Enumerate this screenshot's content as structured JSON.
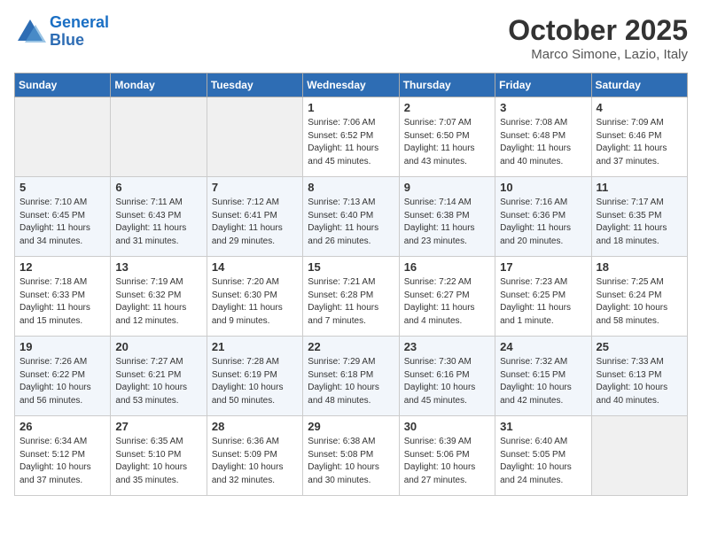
{
  "header": {
    "logo_line1": "General",
    "logo_line2": "Blue",
    "month": "October 2025",
    "location": "Marco Simone, Lazio, Italy"
  },
  "weekdays": [
    "Sunday",
    "Monday",
    "Tuesday",
    "Wednesday",
    "Thursday",
    "Friday",
    "Saturday"
  ],
  "weeks": [
    [
      {
        "day": "",
        "info": ""
      },
      {
        "day": "",
        "info": ""
      },
      {
        "day": "",
        "info": ""
      },
      {
        "day": "1",
        "info": "Sunrise: 7:06 AM\nSunset: 6:52 PM\nDaylight: 11 hours and 45 minutes."
      },
      {
        "day": "2",
        "info": "Sunrise: 7:07 AM\nSunset: 6:50 PM\nDaylight: 11 hours and 43 minutes."
      },
      {
        "day": "3",
        "info": "Sunrise: 7:08 AM\nSunset: 6:48 PM\nDaylight: 11 hours and 40 minutes."
      },
      {
        "day": "4",
        "info": "Sunrise: 7:09 AM\nSunset: 6:46 PM\nDaylight: 11 hours and 37 minutes."
      }
    ],
    [
      {
        "day": "5",
        "info": "Sunrise: 7:10 AM\nSunset: 6:45 PM\nDaylight: 11 hours and 34 minutes."
      },
      {
        "day": "6",
        "info": "Sunrise: 7:11 AM\nSunset: 6:43 PM\nDaylight: 11 hours and 31 minutes."
      },
      {
        "day": "7",
        "info": "Sunrise: 7:12 AM\nSunset: 6:41 PM\nDaylight: 11 hours and 29 minutes."
      },
      {
        "day": "8",
        "info": "Sunrise: 7:13 AM\nSunset: 6:40 PM\nDaylight: 11 hours and 26 minutes."
      },
      {
        "day": "9",
        "info": "Sunrise: 7:14 AM\nSunset: 6:38 PM\nDaylight: 11 hours and 23 minutes."
      },
      {
        "day": "10",
        "info": "Sunrise: 7:16 AM\nSunset: 6:36 PM\nDaylight: 11 hours and 20 minutes."
      },
      {
        "day": "11",
        "info": "Sunrise: 7:17 AM\nSunset: 6:35 PM\nDaylight: 11 hours and 18 minutes."
      }
    ],
    [
      {
        "day": "12",
        "info": "Sunrise: 7:18 AM\nSunset: 6:33 PM\nDaylight: 11 hours and 15 minutes."
      },
      {
        "day": "13",
        "info": "Sunrise: 7:19 AM\nSunset: 6:32 PM\nDaylight: 11 hours and 12 minutes."
      },
      {
        "day": "14",
        "info": "Sunrise: 7:20 AM\nSunset: 6:30 PM\nDaylight: 11 hours and 9 minutes."
      },
      {
        "day": "15",
        "info": "Sunrise: 7:21 AM\nSunset: 6:28 PM\nDaylight: 11 hours and 7 minutes."
      },
      {
        "day": "16",
        "info": "Sunrise: 7:22 AM\nSunset: 6:27 PM\nDaylight: 11 hours and 4 minutes."
      },
      {
        "day": "17",
        "info": "Sunrise: 7:23 AM\nSunset: 6:25 PM\nDaylight: 11 hours and 1 minute."
      },
      {
        "day": "18",
        "info": "Sunrise: 7:25 AM\nSunset: 6:24 PM\nDaylight: 10 hours and 58 minutes."
      }
    ],
    [
      {
        "day": "19",
        "info": "Sunrise: 7:26 AM\nSunset: 6:22 PM\nDaylight: 10 hours and 56 minutes."
      },
      {
        "day": "20",
        "info": "Sunrise: 7:27 AM\nSunset: 6:21 PM\nDaylight: 10 hours and 53 minutes."
      },
      {
        "day": "21",
        "info": "Sunrise: 7:28 AM\nSunset: 6:19 PM\nDaylight: 10 hours and 50 minutes."
      },
      {
        "day": "22",
        "info": "Sunrise: 7:29 AM\nSunset: 6:18 PM\nDaylight: 10 hours and 48 minutes."
      },
      {
        "day": "23",
        "info": "Sunrise: 7:30 AM\nSunset: 6:16 PM\nDaylight: 10 hours and 45 minutes."
      },
      {
        "day": "24",
        "info": "Sunrise: 7:32 AM\nSunset: 6:15 PM\nDaylight: 10 hours and 42 minutes."
      },
      {
        "day": "25",
        "info": "Sunrise: 7:33 AM\nSunset: 6:13 PM\nDaylight: 10 hours and 40 minutes."
      }
    ],
    [
      {
        "day": "26",
        "info": "Sunrise: 6:34 AM\nSunset: 5:12 PM\nDaylight: 10 hours and 37 minutes."
      },
      {
        "day": "27",
        "info": "Sunrise: 6:35 AM\nSunset: 5:10 PM\nDaylight: 10 hours and 35 minutes."
      },
      {
        "day": "28",
        "info": "Sunrise: 6:36 AM\nSunset: 5:09 PM\nDaylight: 10 hours and 32 minutes."
      },
      {
        "day": "29",
        "info": "Sunrise: 6:38 AM\nSunset: 5:08 PM\nDaylight: 10 hours and 30 minutes."
      },
      {
        "day": "30",
        "info": "Sunrise: 6:39 AM\nSunset: 5:06 PM\nDaylight: 10 hours and 27 minutes."
      },
      {
        "day": "31",
        "info": "Sunrise: 6:40 AM\nSunset: 5:05 PM\nDaylight: 10 hours and 24 minutes."
      },
      {
        "day": "",
        "info": ""
      }
    ]
  ]
}
